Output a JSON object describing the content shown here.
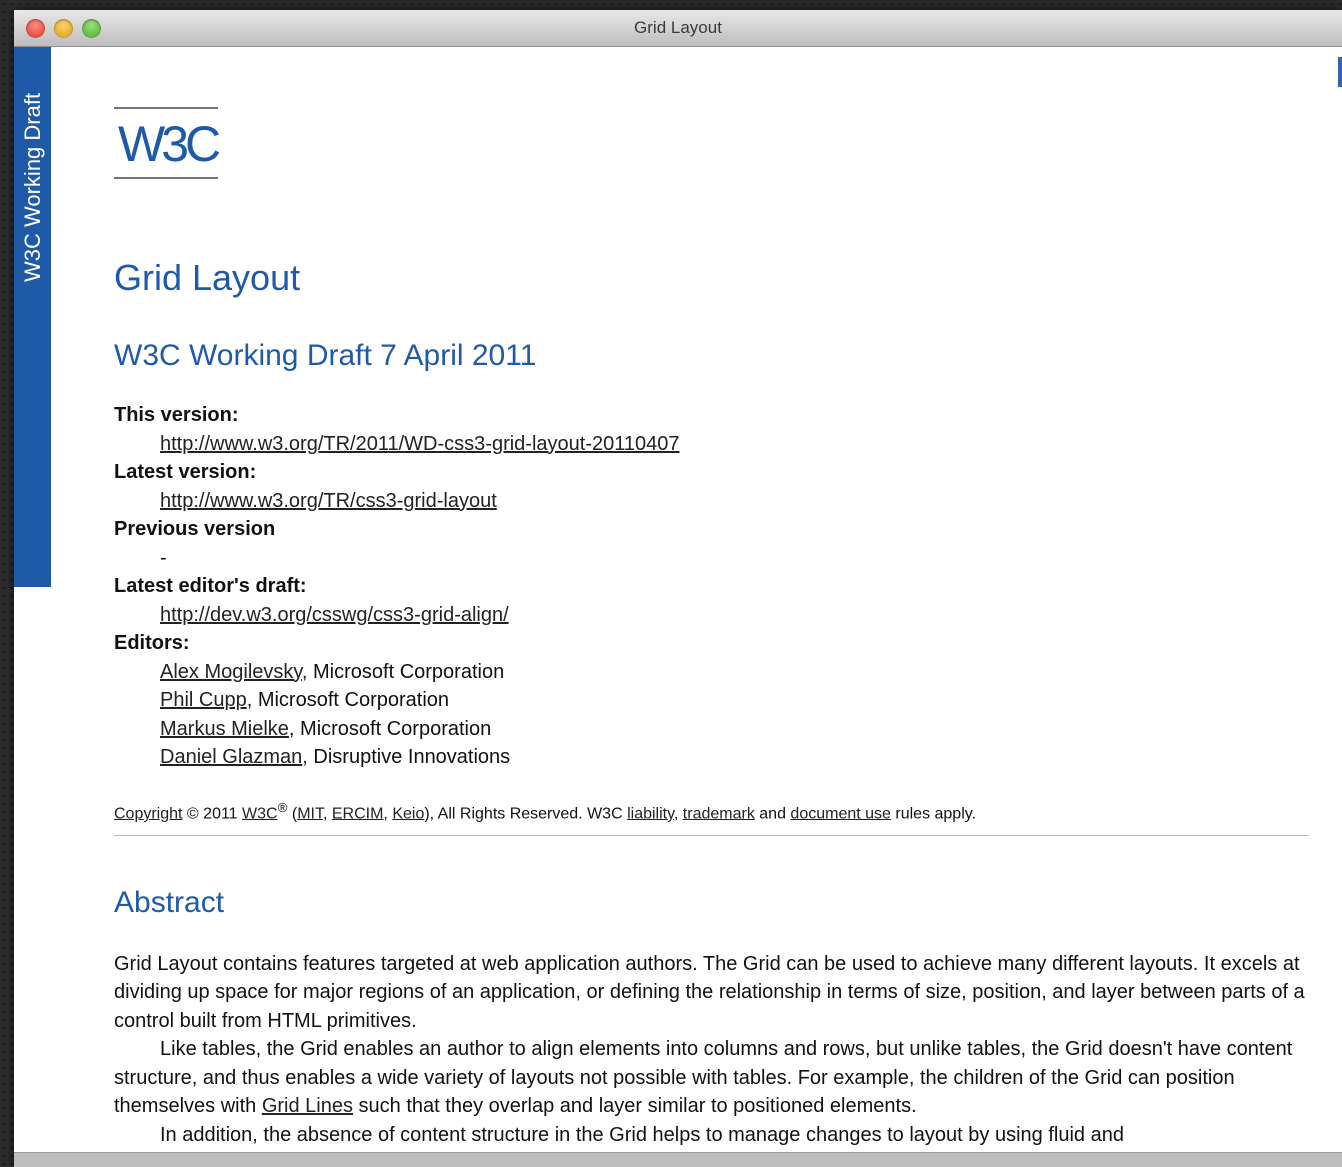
{
  "window": {
    "title": "Grid Layout"
  },
  "banner": {
    "text": "W3C Working Draft"
  },
  "logo": {
    "text": "W3C"
  },
  "doc": {
    "title": "Grid Layout",
    "subtitle": "W3C Working Draft 7 April 2011",
    "this_version_label": "This version:",
    "this_version_url": "http://www.w3.org/TR/2011/WD-css3-grid-layout-20110407",
    "latest_version_label": "Latest version:",
    "latest_version_url": "http://www.w3.org/TR/css3-grid-layout",
    "previous_version_label": "Previous version",
    "previous_version_value": "-",
    "editors_draft_label": "Latest editor's draft:",
    "editors_draft_url": "http://dev.w3.org/csswg/css3-grid-align/",
    "editors_label": "Editors:",
    "editors": [
      {
        "name": "Alex Mogilevsky",
        "org": ", Microsoft Corporation"
      },
      {
        "name": "Phil Cupp",
        "org": ", Microsoft Corporation"
      },
      {
        "name": "Markus Mielke",
        "org": ", Microsoft Corporation"
      },
      {
        "name": "Daniel Glazman",
        "org": ", Disruptive Innovations"
      }
    ],
    "copyright": {
      "link": "Copyright",
      "text1": " © 2011 ",
      "w3c": "W3C",
      "sup": "®",
      "text2": " (",
      "mit": "MIT",
      "comma1": ", ",
      "ercim": "ERCIM",
      "comma2": ", ",
      "keio": "Keio",
      "text3": "), All Rights Reserved. W3C ",
      "liability": "liability",
      "comma3": ", ",
      "trademark": "trademark",
      "and": " and ",
      "document_use": "document use",
      "end": " rules apply."
    },
    "abstract_title": "Abstract",
    "abstract_p1": "Grid Layout contains features targeted at web application authors. The Grid can be used to achieve many different layouts. It excels at dividing up space for major regions of an application, or defining the relationship in terms of size, position, and layer between parts of a control built from HTML primitives.",
    "abstract_p2a": "Like tables, the Grid enables an author to align elements into columns and rows, but unlike tables, the Grid doesn't have content structure, and thus enables a wide variety of layouts not possible with tables. For example, the children of the Grid can position themselves with ",
    "abstract_p2_link": "Grid Lines",
    "abstract_p2b": " such that they overlap and layer similar to positioned elements.",
    "abstract_p3": "In addition, the absence of content structure in the Grid helps to manage changes to layout by using fluid and"
  }
}
